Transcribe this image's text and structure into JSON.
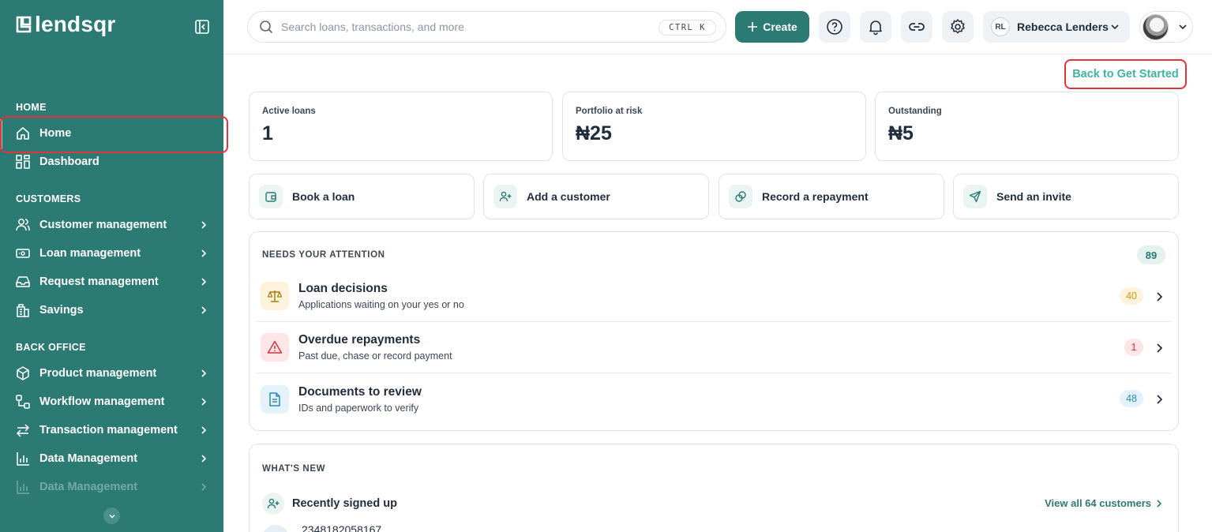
{
  "brand": {
    "name": "lendsqr"
  },
  "sidebar": {
    "sections": [
      {
        "label": "HOME"
      },
      {
        "label": "CUSTOMERS"
      },
      {
        "label": "BACK OFFICE"
      }
    ],
    "items": [
      {
        "label": "Home",
        "icon": "home-icon"
      },
      {
        "label": "Dashboard",
        "icon": "dashboard-icon"
      },
      {
        "label": "Customer management",
        "icon": "users-icon"
      },
      {
        "label": "Loan management",
        "icon": "loan-icon"
      },
      {
        "label": "Request management",
        "icon": "inbox-icon"
      },
      {
        "label": "Savings",
        "icon": "savings-icon"
      },
      {
        "label": "Product management",
        "icon": "box-icon"
      },
      {
        "label": "Workflow management",
        "icon": "workflow-icon"
      },
      {
        "label": "Transaction management",
        "icon": "transfer-icon"
      },
      {
        "label": "Data Management",
        "icon": "bar-chart-icon"
      },
      {
        "label": "Data Management",
        "icon": "bar-chart-icon"
      }
    ]
  },
  "topbar": {
    "search_placeholder": "Search loans, transactions, and more",
    "shortcut": "CTRL K",
    "create_label": "Create",
    "user_initials": "RL",
    "user_name": "Rebecca Lenders"
  },
  "back_link": "Back to Get Started",
  "stats": [
    {
      "label": "Active loans",
      "value": "1"
    },
    {
      "label": "Portfolio at risk",
      "value": "₦25"
    },
    {
      "label": "Outstanding",
      "value": "₦5"
    }
  ],
  "actions": [
    {
      "label": "Book a loan",
      "icon": "wallet-icon"
    },
    {
      "label": "Add a customer",
      "icon": "user-plus-icon"
    },
    {
      "label": "Record a repayment",
      "icon": "coins-icon"
    },
    {
      "label": "Send an invite",
      "icon": "send-icon"
    }
  ],
  "attention": {
    "title": "NEEDS YOUR ATTENTION",
    "count": "89",
    "rows": [
      {
        "title": "Loan decisions",
        "subtitle": "Applications waiting on your yes or no",
        "count": "40",
        "icon": "scale-icon"
      },
      {
        "title": "Overdue repayments",
        "subtitle": "Past due, chase or record payment",
        "count": "1",
        "icon": "warning-icon"
      },
      {
        "title": "Documents to review",
        "subtitle": "IDs and paperwork to verify",
        "count": "48",
        "icon": "document-icon"
      }
    ]
  },
  "whats_new": {
    "title": "WHAT'S NEW",
    "recent_label": "Recently signed up",
    "view_all": "View all 64 customers",
    "first_customer": "2348182058167"
  },
  "colors": {
    "brand": "#2b7a73",
    "accent_link": "#3fb3a6",
    "highlight": "#e0353b"
  }
}
